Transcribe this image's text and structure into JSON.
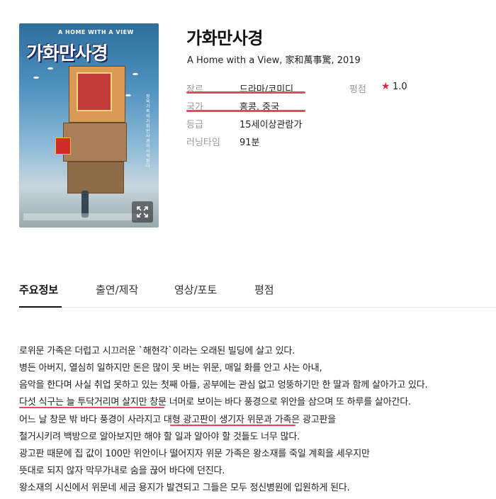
{
  "poster": {
    "subtitle_text": "A HOME WITH A VIEW",
    "title_text": "가화만사경",
    "vertical_text": "정육가족의가화만사경이시작된다"
  },
  "movie": {
    "title": "가화만사경",
    "subtitle": "A Home with a View, 家和萬事驚, 2019"
  },
  "info": {
    "genre_label": "장르",
    "genre_value": "드라마/코미디",
    "country_label": "국가",
    "country_value": "홍콩, 중국",
    "rating_grade_label": "등급",
    "rating_grade_value": "15세이상관람가",
    "runtime_label": "러닝타임",
    "runtime_value": "91분",
    "score_label": "평점",
    "score_star": "★",
    "score_value": "1.0"
  },
  "colors": {
    "highlight": "#e6485e",
    "star": "#d22b3a"
  },
  "tabs": [
    {
      "label": "주요정보"
    },
    {
      "label": "출연/제작"
    },
    {
      "label": "영상/포토"
    },
    {
      "label": "평점"
    }
  ],
  "synopsis": [
    "로위문 가족은 더럽고 시끄러운 `해현각`이라는 오래된 빌딩에 살고 있다.",
    "병든 아버지, 열심히 일하지만 돈은 많이 못 버는 위문, 매일 화를 안고 사는 아내,",
    "음악을 한다며 사실 취업 못하고 있는 첫째 아들, 공부에는 관심 없고 엉뚱하기만 한 딸과 함께 살아가고 있다.",
    "다섯 식구는 늘 투닥거리며 살지만 창문 너머로 보이는 바다 풍경으로 위안을 삼으며 또 하루를 살아간다.",
    "어느 날 창문 밖 바다 풍경이 사라지고 대형 광고판이 생기자 위문과 가족은 광고판을",
    "철거시키려 백방으로 알아보지만 해야 할 일과 알아야 할 것들도 너무 많다.",
    "광고판 때문에 집 값이 100만 위안이나 떨어지자 위문 가족은 왕소재를 죽일 계획을 세우지만",
    "뜻대로 되지 않자 막무가내로 숨을 끊어 바다에 던진다.",
    "왕소재의 시신에서 위문네 세금 용지가 발견되고 그들은 모두 정신병원에 입원하게 된다."
  ]
}
